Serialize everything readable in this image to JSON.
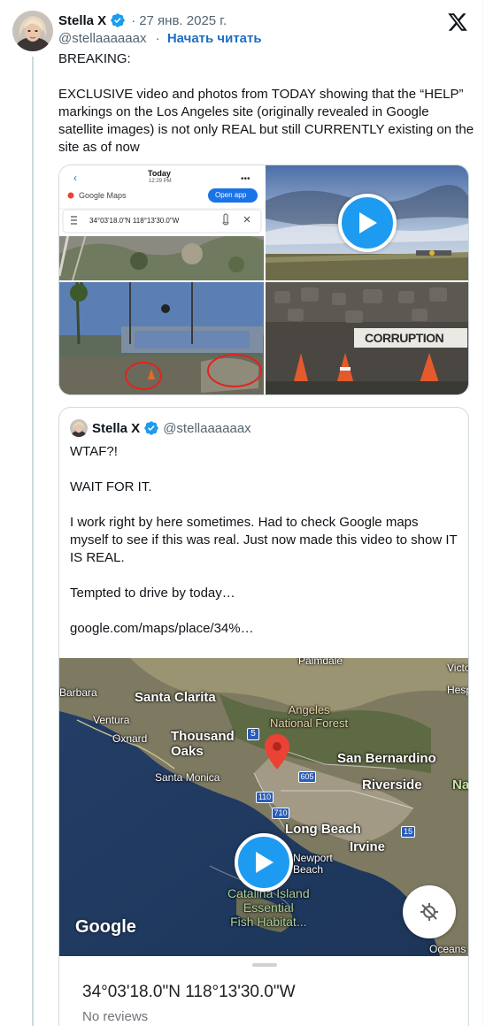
{
  "tweet": {
    "author_name": "Stella X",
    "handle": "@stellaaaaaax",
    "date": "27 янв. 2025 г.",
    "follow_label": "Начать читать",
    "separator": "·",
    "text_lines": [
      "BREAKING:",
      "",
      "EXCLUSIVE video and photos from TODAY showing that the “HELP” markings on the Los Angeles site (originally revealed in Google satellite images) is not only REAL but still CURRENTLY existing on the site as of now"
    ],
    "media": {
      "phone_header_title": "Today",
      "phone_header_time": "12:29 PM",
      "phone_app_name": "Google Maps",
      "phone_open_app": "Open app",
      "phone_search_value": "34°03'18.0\"N 118°13'30.0\"W",
      "sign_text": "CORRUPTION"
    }
  },
  "quote": {
    "author_name": "Stella X",
    "handle": "@stellaaaaaax",
    "paragraphs": [
      "WTAF?!",
      "WAIT FOR IT.",
      "I work right by here sometimes. Had to check Google maps myself to see if this was real. Just now made this video to show IT IS REAL.",
      "Tempted to drive by today…",
      "google.com/maps/place/34%…"
    ],
    "map": {
      "labels": {
        "palmdale": "Palmdale",
        "victorville": "Victo",
        "hesperia": "Hesp",
        "barbara": "Barbara",
        "santa_clarita": "Santa Clarita",
        "ventura": "Ventura",
        "angeles_nf": "Angeles\nNational Forest",
        "oxnard": "Oxnard",
        "thousand_oaks": "Thousand\nOaks",
        "san_bernardino": "San Bernardino",
        "santa_monica": "Santa Monica",
        "riverside": "Riverside",
        "na": "Na",
        "long_beach": "Long Beach",
        "irvine": "Irvine",
        "newport_beach": "Newport\nBeach",
        "catalina": "Catalina Island\nEssential\nFish Habitat...",
        "oceans": "Oceans",
        "route_5": "5",
        "route_605": "605",
        "route_110": "110",
        "route_710": "710",
        "route_15": "15"
      },
      "google_logo": "Google"
    },
    "place": {
      "coordinates": "34°03'18.0\"N 118°13'30.0\"W",
      "reviews": "No reviews"
    }
  },
  "colors": {
    "accent": "#1d9bf0",
    "verified": "#1d9bf0",
    "link": "#1d6fc4",
    "secondary_text": "#536471",
    "pin": "#ea4335"
  },
  "icons": {
    "verified": "verified-badge-icon",
    "x_logo": "x-logo-icon",
    "play": "play-icon",
    "locate": "locate-icon",
    "pin": "map-pin-icon"
  }
}
